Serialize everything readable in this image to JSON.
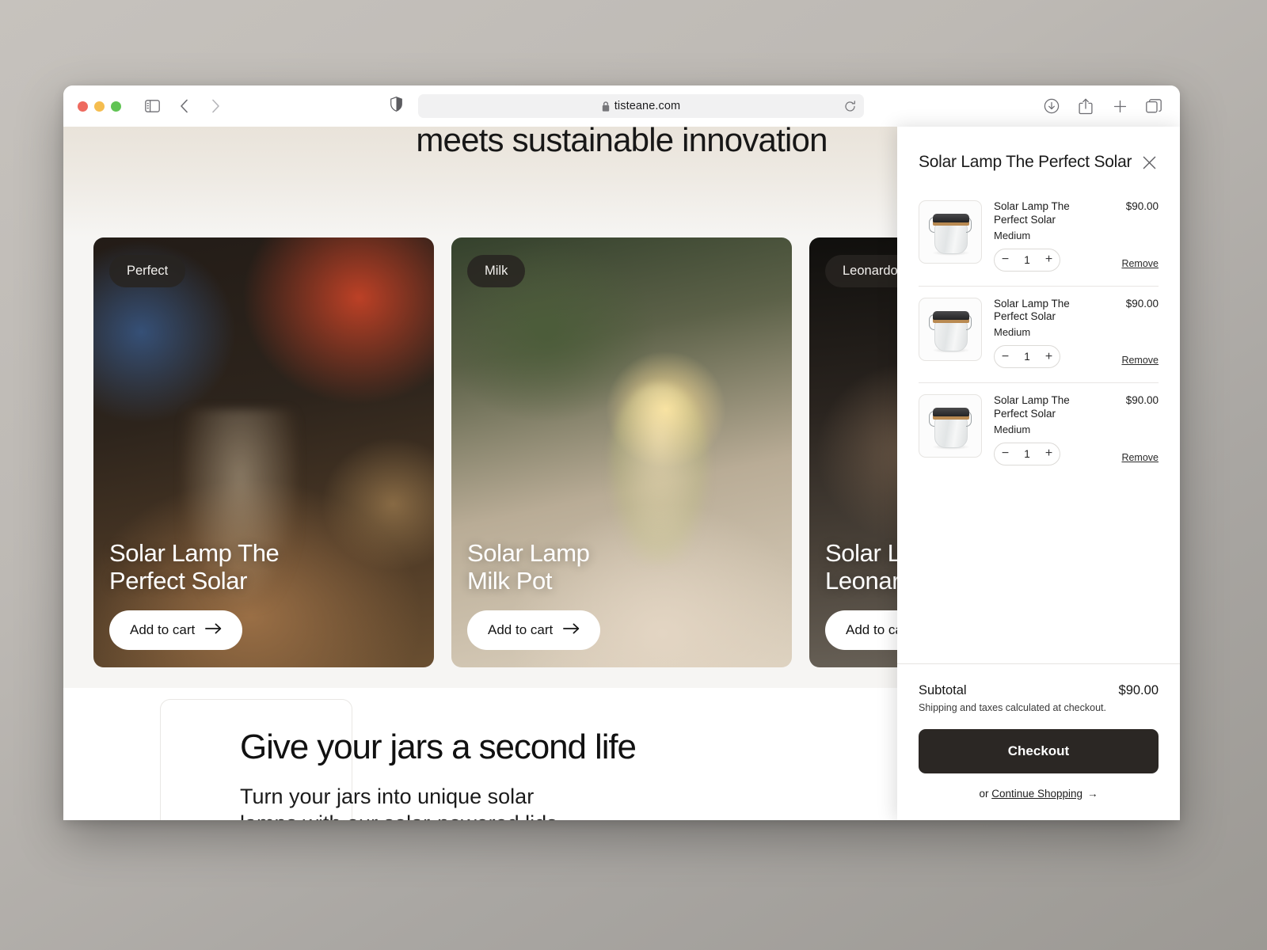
{
  "browser": {
    "url": "tisteane.com",
    "lock_icon": "lock-icon",
    "reload_icon": "reload-icon",
    "sidebar_icon": "sidebar-toggle-icon",
    "back_icon": "back-chevron-icon",
    "forward_icon": "forward-chevron-icon",
    "shield_icon": "privacy-shield-icon",
    "right_icons": [
      {
        "name": "downloads-icon"
      },
      {
        "name": "share-icon"
      },
      {
        "name": "new-tab-icon"
      },
      {
        "name": "tab-overview-icon"
      }
    ],
    "traffic_lights": [
      {
        "name": "close-window-button",
        "color": "#ee6a5f"
      },
      {
        "name": "minimize-window-button",
        "color": "#f5bd4f"
      },
      {
        "name": "maximize-window-button",
        "color": "#61c454"
      }
    ]
  },
  "page": {
    "hero_heading": "eco-friendly solar lamps—where timeless\ndesign meets sustainable innovation",
    "cards": [
      {
        "badge": "Perfect",
        "title": "Solar Lamp The\nPerfect Solar",
        "cta": "Add to cart",
        "cta_icon": "arrow-right-icon"
      },
      {
        "badge": "Milk",
        "title": "Solar Lamp\nMilk Pot",
        "cta": "Add to cart",
        "cta_icon": "arrow-right-icon"
      },
      {
        "badge": "Leonardo",
        "title": "Solar Lamp\nLeonardo",
        "cta": "Add to cart",
        "cta_icon": "arrow-right-icon"
      }
    ],
    "promo": {
      "heading": "Give your jars a second life",
      "body": "Turn your jars into unique solar\nlamps with our solar-powered lids"
    }
  },
  "cart": {
    "title": "Solar Lamp The Perfect Solar",
    "close_icon": "close-icon",
    "items": [
      {
        "name": "Solar Lamp The\nPerfect Solar",
        "variant": "Medium",
        "price": "$90.00",
        "quantity": "1",
        "decrease_label": "−",
        "increase_label": "+",
        "remove_label": "Remove",
        "thumb_icon": "jar-lamp-thumbnail"
      },
      {
        "name": "Solar Lamp The\nPerfect Solar",
        "variant": "Medium",
        "price": "$90.00",
        "quantity": "1",
        "decrease_label": "−",
        "increase_label": "+",
        "remove_label": "Remove",
        "thumb_icon": "jar-lamp-thumbnail"
      },
      {
        "name": "Solar Lamp The\nPerfect Solar",
        "variant": "Medium",
        "price": "$90.00",
        "quantity": "1",
        "decrease_label": "−",
        "increase_label": "+",
        "remove_label": "Remove",
        "thumb_icon": "jar-lamp-thumbnail"
      }
    ],
    "subtotal_label": "Subtotal",
    "subtotal_value": "$90.00",
    "shipping_note": "Shipping and taxes calculated at checkout.",
    "checkout_label": "Checkout",
    "continue_prefix": "or ",
    "continue_label": "Continue Shopping",
    "continue_arrow": "→"
  },
  "colors": {
    "checkout_bg": "#2b2724",
    "badge_bg": "rgba(40,36,33,0.86)",
    "page_bg": "#ffffff"
  }
}
